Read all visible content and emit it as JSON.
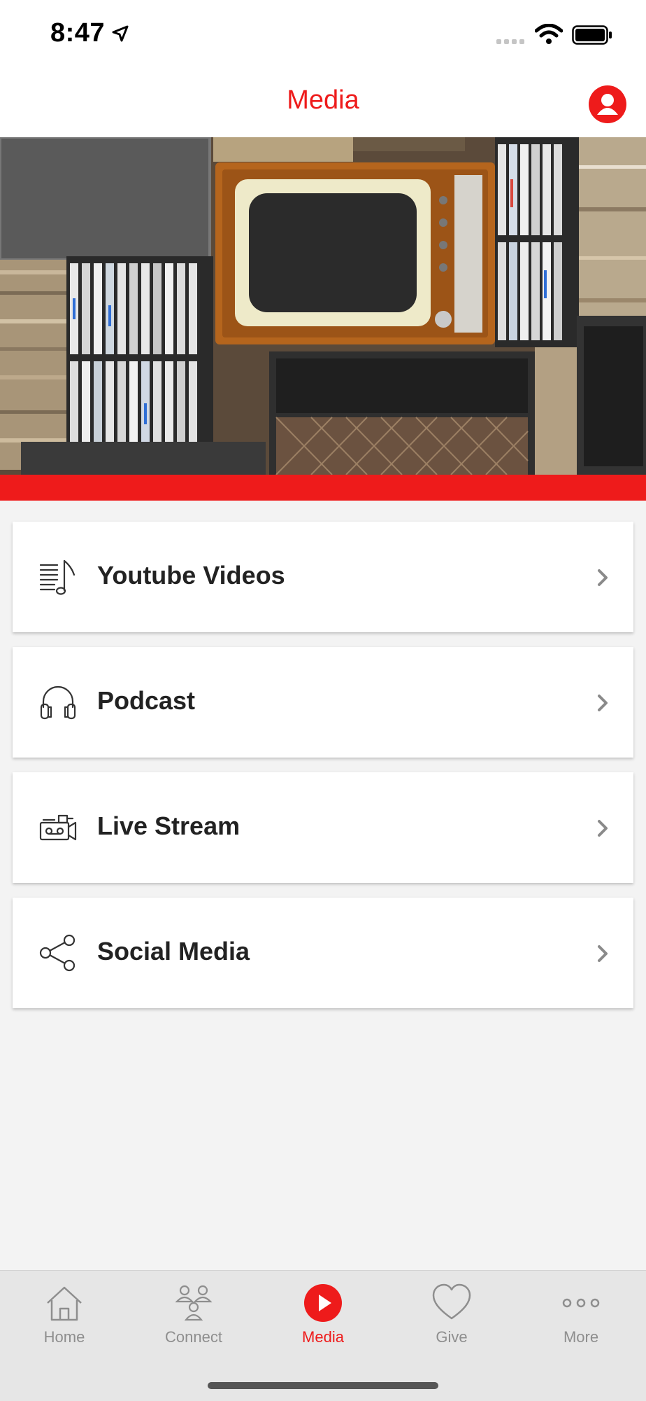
{
  "status_bar": {
    "time": "8:47"
  },
  "header": {
    "title": "Media"
  },
  "menu": [
    {
      "label": "Youtube Videos",
      "icon": "music-list-icon"
    },
    {
      "label": "Podcast",
      "icon": "headphones-icon"
    },
    {
      "label": "Live Stream",
      "icon": "video-camera-icon"
    },
    {
      "label": "Social Media",
      "icon": "share-icon"
    }
  ],
  "tabs": [
    {
      "label": "Home",
      "icon": "home-icon",
      "active": false
    },
    {
      "label": "Connect",
      "icon": "people-icon",
      "active": false
    },
    {
      "label": "Media",
      "icon": "play-icon",
      "active": true
    },
    {
      "label": "Give",
      "icon": "heart-icon",
      "active": false
    },
    {
      "label": "More",
      "icon": "more-dots-icon",
      "active": false
    }
  ],
  "colors": {
    "accent": "#ee1b1b",
    "background": "#f3f3f3",
    "tabbar": "#e6e6e6"
  }
}
